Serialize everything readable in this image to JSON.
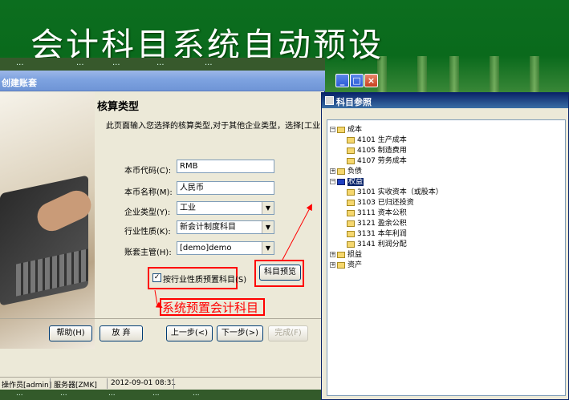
{
  "slide": {
    "title": "会计科目系统自动预设"
  },
  "back_strip_items": [
    "...",
    "...",
    "...",
    "...",
    "..."
  ],
  "wizard": {
    "title": "创建账套",
    "heading": "核算类型",
    "description": "此页面输入您选择的核算类型,对于其他企业类型，选择[工业",
    "fields": {
      "currency_code_label": "本币代码(C):",
      "currency_code_value": "RMB",
      "currency_name_label": "本币名称(M):",
      "currency_name_value": "人民币",
      "enterprise_type_label": "企业类型(Y):",
      "enterprise_type_value": "工业",
      "industry_label": "行业性质(K):",
      "industry_value": "新会计制度科目",
      "supervisor_label": "账套主管(H):",
      "supervisor_value": "[demo]demo"
    },
    "checkbox_label": "按行业性质预置科目(S)",
    "preview_button": "科目预览",
    "annotation": "系统预置会计科目",
    "buttons": {
      "help": "帮助(H)",
      "cancel": "放 弃",
      "prev": "上一步(<)",
      "next": "下一步(>)",
      "finish": "完成(F)"
    },
    "win_buttons": {
      "minimize": "_",
      "maximize": "□",
      "close": "×"
    }
  },
  "statusbar": {
    "operator": "操作员[admin]",
    "server": "服务器[ZMK]",
    "datetime": "2012-09-01 08:31"
  },
  "reference_window": {
    "title": "科目参照",
    "tree": [
      {
        "label": "成本",
        "expander": "−",
        "children": [
          "4101 生产成本",
          "4105 制造费用",
          "4107 劳务成本"
        ]
      },
      {
        "label": "负债",
        "expander": "+"
      },
      {
        "label": "权益",
        "expander": "−",
        "selected": true,
        "children": [
          "3101 实收资本（或股本）",
          "3103 已归还投资",
          "3111 资本公积",
          "3121 盈余公积",
          "3131 本年利润",
          "3141 利润分配"
        ]
      },
      {
        "label": "损益",
        "expander": "+"
      },
      {
        "label": "资产",
        "expander": "+"
      }
    ]
  },
  "colors": {
    "annotation_red": "#ff0000",
    "slide_green": "#0c6e1f"
  }
}
